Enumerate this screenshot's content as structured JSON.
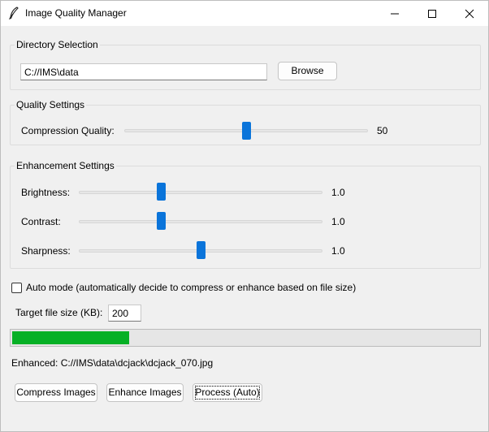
{
  "window": {
    "title": "Image Quality Manager",
    "icon": "feather-icon"
  },
  "directory": {
    "group_title": "Directory Selection",
    "path_value": "C://IMS\\data",
    "browse_label": "Browse"
  },
  "quality": {
    "group_title": "Quality Settings",
    "compression_label": "Compression Quality:",
    "compression_value": "50",
    "compression_min": 0,
    "compression_max": 100
  },
  "enhancement": {
    "group_title": "Enhancement Settings",
    "sliders": [
      {
        "label": "Brightness:",
        "value": "1.0",
        "level": 0.333
      },
      {
        "label": "Contrast:",
        "value": "1.0",
        "level": 0.333
      },
      {
        "label": "Sharpness:",
        "value": "1.0",
        "level": 0.5
      }
    ]
  },
  "auto_mode": {
    "label": "Auto mode (automatically decide to compress or enhance based on file size)",
    "checked": false
  },
  "target": {
    "label": "Target file size (KB):",
    "value": "200"
  },
  "progress": {
    "percent": 25,
    "color": "#06b025"
  },
  "status": {
    "text": "Enhanced: C://IMS\\data\\dcjack\\dcjack_070.jpg"
  },
  "actions": {
    "compress_label": "Compress Images",
    "enhance_label": "Enhance Images",
    "process_label": "Process (Auto)"
  },
  "colors": {
    "slider_thumb": "#0a74da",
    "accent": "#06b025"
  }
}
